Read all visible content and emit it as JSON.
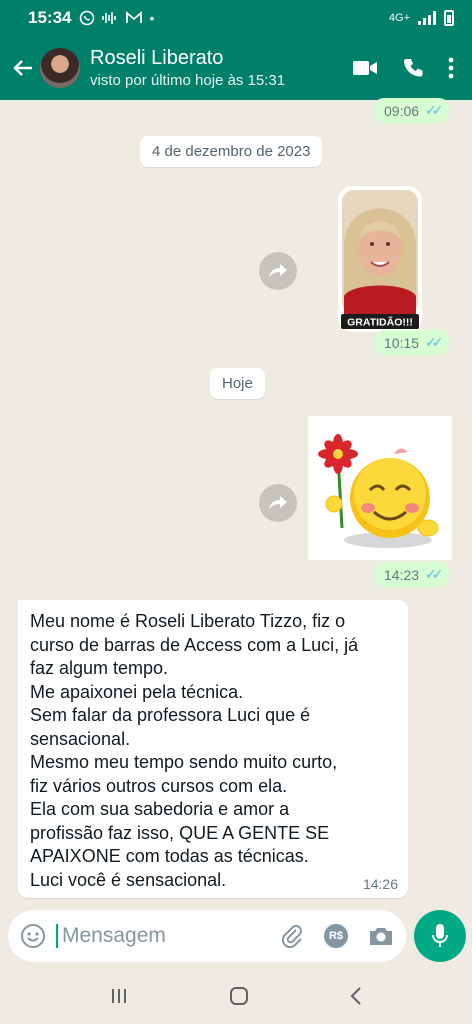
{
  "status_bar": {
    "time": "15:34",
    "network": "4G+"
  },
  "header": {
    "contact_name": "Roseli Liberato",
    "last_seen": "visto por último hoje às 15:31"
  },
  "messages": {
    "first_time": "09:06",
    "date_chip_1": "4 de dezembro de 2023",
    "sticker1": {
      "caption": "GRATIDÃO!!!",
      "time": "10:15"
    },
    "date_chip_2": "Hoje",
    "sticker2": {
      "time": "14:23"
    },
    "incoming": {
      "lines": [
        "Meu nome é Roseli Liberato Tizzo, fiz o",
        "curso de barras de Access com a Luci, já",
        "faz algum tempo.",
        "Me apaixonei pela técnica.",
        "Sem falar da professora Luci que é",
        "sensacional.",
        "Mesmo meu tempo sendo muito curto,",
        "fiz vários outros cursos com ela.",
        "Ela com sua sabedoria e amor a",
        "profissão faz isso, QUE A GENTE SE",
        "APAIXONE com todas as técnicas.",
        "Luci você é sensacional."
      ],
      "time": "14:26"
    }
  },
  "composer": {
    "placeholder": "Mensagem",
    "payment_badge": "R$"
  },
  "colors": {
    "header": "#008069",
    "chat_bg": "#efeae2",
    "outgoing_bubble": "#d9fdd3",
    "accent": "#00a884",
    "read_ticks": "#53bdeb"
  },
  "icons": {
    "back": "arrow-left-icon",
    "video": "video-call-icon",
    "call": "phone-icon",
    "menu": "more-vert-icon",
    "forward": "forward-icon",
    "emoji": "emoji-icon",
    "attach": "paperclip-icon",
    "camera": "camera-icon",
    "mic": "microphone-icon"
  }
}
